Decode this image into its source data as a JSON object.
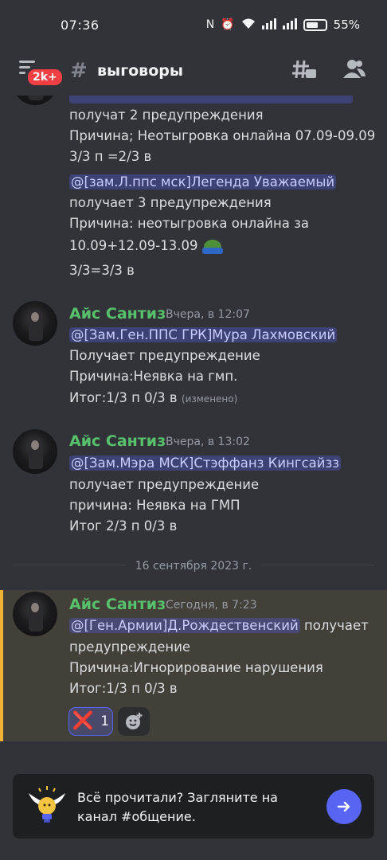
{
  "status_bar": {
    "time": "07:36",
    "battery": "55%"
  },
  "header": {
    "badge": "2k+",
    "channel_name": "выговоры"
  },
  "messages": [
    {
      "lines": [
        "получат 2 предупреждения",
        "Причина; Неотыгровка онлайна 07.09-09.09",
        "3/3 п =2/3 в"
      ],
      "mention": "@[зам.Л.ппс мск]Легенда Уважаемый",
      "after_lines": [
        "получает 3 предупреждения",
        "Причина: неотыгровка онлайна за",
        "10.09+12.09-13.09",
        "3/3=3/3 в"
      ]
    },
    {
      "author": "Айс Сантиз",
      "timestamp": "Вчера, в 12:07",
      "mention": "@[Зам.Ген.ППС ГРК]Мура Лахмовский",
      "lines": [
        "Получает предупреждение",
        "Причина:Неявка на гмп.",
        "Итог:1/3 п 0/3 в"
      ],
      "edited": "(изменено)"
    },
    {
      "author": "Айс Сантиз",
      "timestamp": "Вчера, в 13:02",
      "mention": "@[Зам.Мэра МСК]Стэффанз Кингсайзз",
      "lines": [
        "получает предупреждение",
        "причина: Неявка на ГМП",
        "Итог 2/3 п 0/3 в"
      ]
    },
    {
      "author": "Айс Сантиз",
      "timestamp": "Сегодня, в 7:23",
      "mention": "@[Ген.Армии]Д.Рождественский",
      "mention_suffix": "получает",
      "lines": [
        "предупреждение",
        "Причина:Игнорирование нарушения",
        "Итог:1/3 п 0/3 в"
      ],
      "reaction": {
        "emoji": "❌",
        "count": "1"
      }
    }
  ],
  "date_divider": "16 сентября 2023 г.",
  "banner": {
    "line1": "Всё прочитали? Загляните на",
    "line2": "канал #общение."
  },
  "colors": {
    "background": "#313338",
    "username": "#57c26b",
    "mention_bg": "#4c4f8f",
    "accent": "#5865f2",
    "highlight_bar": "#f0b232"
  }
}
